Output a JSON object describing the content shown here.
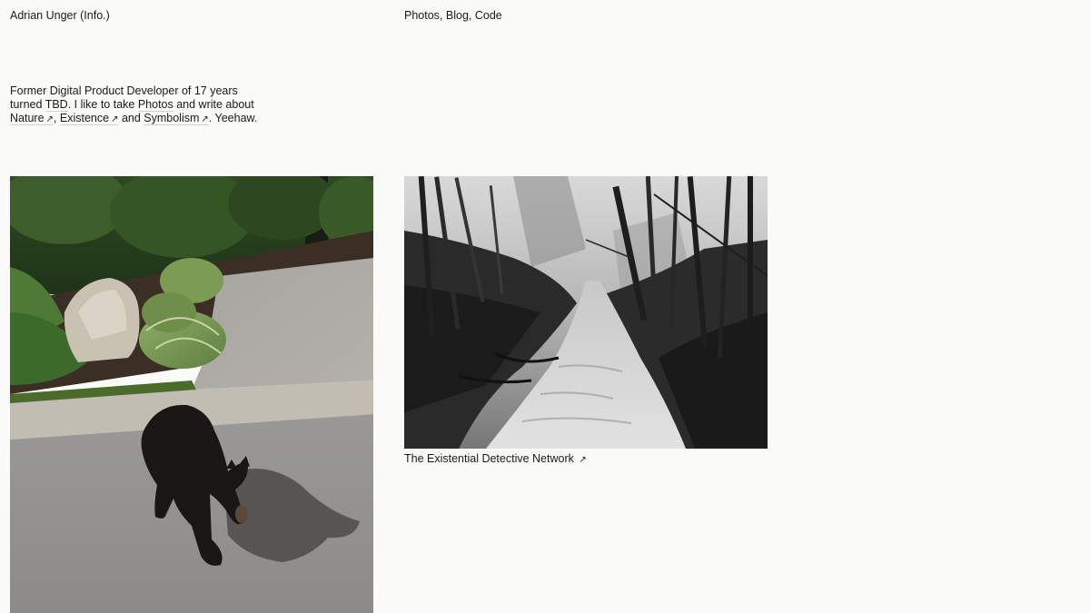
{
  "header": {
    "name": "Adrian Unger",
    "info_link": "(Info.)"
  },
  "nav": {
    "photos": "Photos",
    "sep1": ", ",
    "blog": "Blog",
    "sep2": ", ",
    "code": "Code"
  },
  "bio": {
    "t1": "Former Digital Product Developer of 17 years turned ",
    "tbd": "TBD",
    "t2": ". I like to take ",
    "photos": "Photos",
    "t3": " and write about ",
    "nature": "Nature",
    "t4": ", ",
    "existence": "Existence",
    "t5": " and ",
    "symbolism": "Symbolism",
    "t6": ". Yeehaw.",
    "arrow": "↗"
  },
  "gallery": {
    "caption": "The Existential Detective Network",
    "arrow": "↗"
  },
  "colors": {
    "background": "#fafaf9",
    "text": "#1a1a1a",
    "link_underline": "#cfcfcf"
  }
}
